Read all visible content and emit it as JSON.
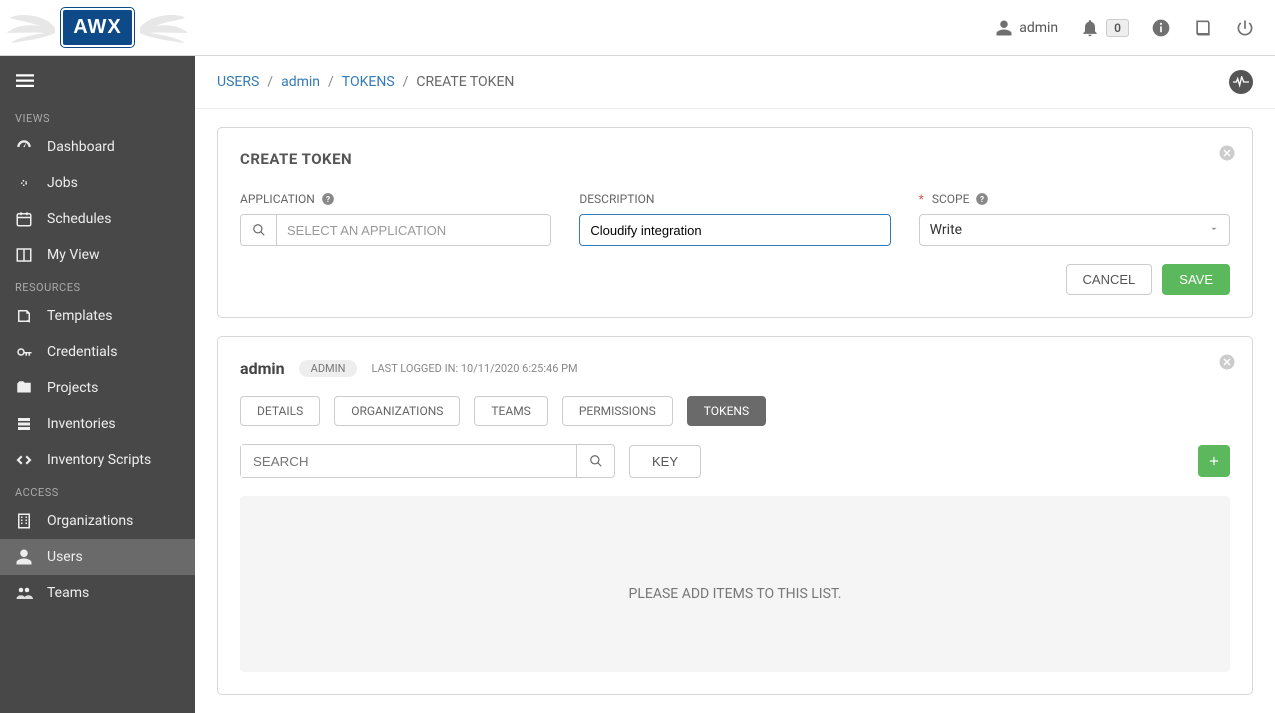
{
  "header": {
    "logo": "AWX",
    "username": "admin",
    "notif_count": "0"
  },
  "sidebar": {
    "sections": [
      {
        "label": "VIEWS",
        "items": [
          {
            "icon": "dashboard-icon",
            "label": "Dashboard"
          },
          {
            "icon": "jobs-icon",
            "label": "Jobs"
          },
          {
            "icon": "schedule-icon",
            "label": "Schedules"
          },
          {
            "icon": "myview-icon",
            "label": "My View"
          }
        ]
      },
      {
        "label": "RESOURCES",
        "items": [
          {
            "icon": "templates-icon",
            "label": "Templates"
          },
          {
            "icon": "credentials-icon",
            "label": "Credentials"
          },
          {
            "icon": "projects-icon",
            "label": "Projects"
          },
          {
            "icon": "inventories-icon",
            "label": "Inventories"
          },
          {
            "icon": "scripts-icon",
            "label": "Inventory Scripts"
          }
        ]
      },
      {
        "label": "ACCESS",
        "items": [
          {
            "icon": "organizations-icon",
            "label": "Organizations"
          },
          {
            "icon": "users-icon",
            "label": "Users",
            "active": true
          },
          {
            "icon": "teams-icon",
            "label": "Teams"
          }
        ]
      }
    ]
  },
  "breadcrumb": {
    "users": "USERS",
    "admin": "admin",
    "tokens": "TOKENS",
    "current": "CREATE TOKEN"
  },
  "form": {
    "title": "CREATE TOKEN",
    "application_label": "APPLICATION",
    "application_placeholder": "SELECT AN APPLICATION",
    "description_label": "DESCRIPTION",
    "description_value": "Cloudify integration",
    "scope_label": "SCOPE",
    "scope_value": "Write",
    "cancel": "CANCEL",
    "save": "SAVE"
  },
  "user_panel": {
    "name": "admin",
    "role": "ADMIN",
    "last_login_label": "LAST LOGGED IN:",
    "last_login_value": "10/11/2020 6:25:46 PM",
    "tabs": {
      "details": "DETAILS",
      "organizations": "ORGANIZATIONS",
      "teams": "TEAMS",
      "permissions": "PERMISSIONS",
      "tokens": "TOKENS"
    },
    "search_placeholder": "SEARCH",
    "key_label": "KEY",
    "empty_msg": "PLEASE ADD ITEMS TO THIS LIST."
  }
}
